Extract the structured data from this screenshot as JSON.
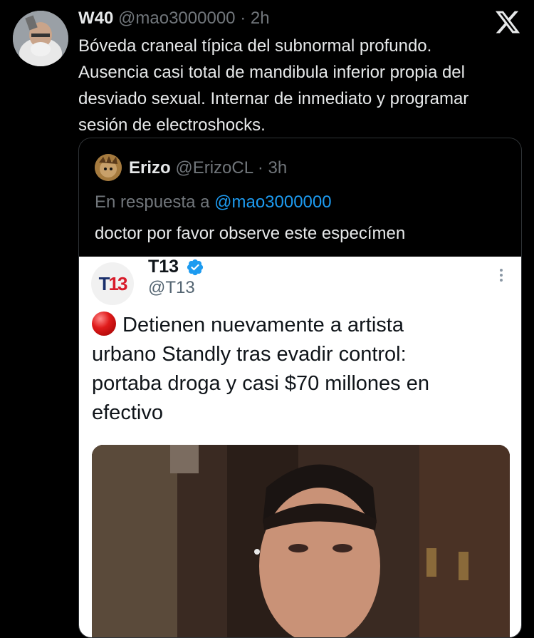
{
  "tweet": {
    "name": "W40",
    "handle": "@mao3000000",
    "separator": "·",
    "time": "2h",
    "lines": [
      "Bóveda craneal típica del subnormal profundo.",
      "Ausencia casi total de mandibula inferior propia del",
      "desviado sexual. Internar de inmediato y programar",
      "sesión de electroshocks."
    ]
  },
  "quote": {
    "name": "Erizo",
    "handle": "@ErizoCL",
    "separator": "·",
    "time": "3h",
    "reply_prefix": "En respuesta a",
    "reply_mention": "@mao3000000",
    "text": "doctor por favor observe este especímen"
  },
  "embed": {
    "logo_t": "T",
    "logo_13": "13",
    "name": "T13",
    "handle": "@T13",
    "lines": [
      "Detienen nuevamente a artista",
      "urbano Standly tras evadir control:",
      "portaba droga y casi $70 millones en",
      "efectivo"
    ]
  },
  "colors": {
    "background": "#000000",
    "text": "#e7e9ea",
    "muted": "#71767b",
    "link": "#1d9bf0",
    "verified": "#1d9bf0"
  },
  "icons": [
    "x-logo-icon",
    "verified-badge-icon",
    "more-options-icon",
    "red-circle-emoji-icon"
  ]
}
